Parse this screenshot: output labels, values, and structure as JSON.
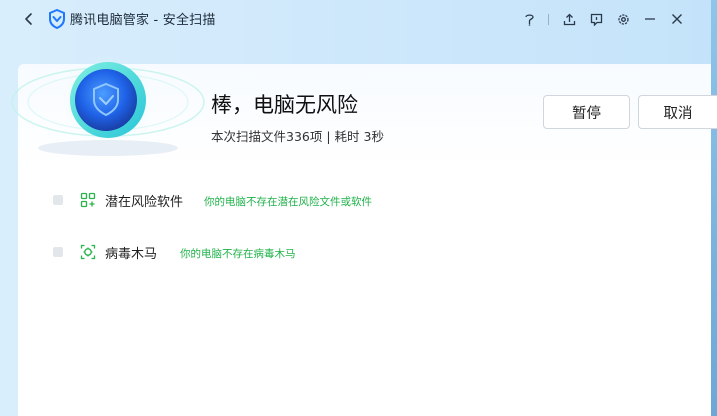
{
  "window": {
    "title": "腾讯电脑管家 - 安全扫描"
  },
  "titlebar_icons": [
    "skin-icon",
    "upload-icon",
    "feedback-icon",
    "settings-icon",
    "minimize-icon",
    "close-icon"
  ],
  "scan": {
    "status_title": "棒，电脑无风险",
    "summary": "本次扫描文件336项 | 耗时 3秒",
    "pause_label": "暂停",
    "cancel_label": "取消"
  },
  "results": [
    {
      "label": "潜在风险软件",
      "status": "你的电脑不存在潜在风险文件或软件",
      "icon": "apps-icon"
    },
    {
      "label": "病毒木马",
      "status": "你的电脑不存在病毒木马",
      "icon": "virus-scan-icon"
    }
  ],
  "colors": {
    "accent_green": "#1fb24a",
    "shield_blue": "#2a6fe6",
    "ring_teal": "#33d6c8"
  }
}
